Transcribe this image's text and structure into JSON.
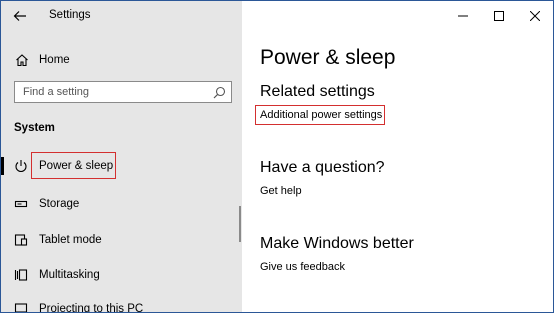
{
  "window": {
    "title": "Settings"
  },
  "sidebar": {
    "home_label": "Home",
    "search_placeholder": "Find a setting",
    "section_header": "System",
    "items": [
      {
        "label": "Power & sleep",
        "icon": "power-icon",
        "selected": true
      },
      {
        "label": "Storage",
        "icon": "storage-icon"
      },
      {
        "label": "Tablet mode",
        "icon": "tablet-mode-icon"
      },
      {
        "label": "Multitasking",
        "icon": "multitasking-icon"
      },
      {
        "label": "Projecting to this PC",
        "icon": "projecting-icon"
      }
    ]
  },
  "main": {
    "page_title": "Power & sleep",
    "related_settings": {
      "heading": "Related settings",
      "link": "Additional power settings"
    },
    "question": {
      "heading": "Have a question?",
      "link": "Get help"
    },
    "feedback": {
      "heading": "Make Windows better",
      "link": "Give us feedback"
    }
  },
  "colors": {
    "sidebar_bg": "#e6e6e6",
    "highlight_border": "#d32f2f",
    "window_border": "#2b5797"
  }
}
